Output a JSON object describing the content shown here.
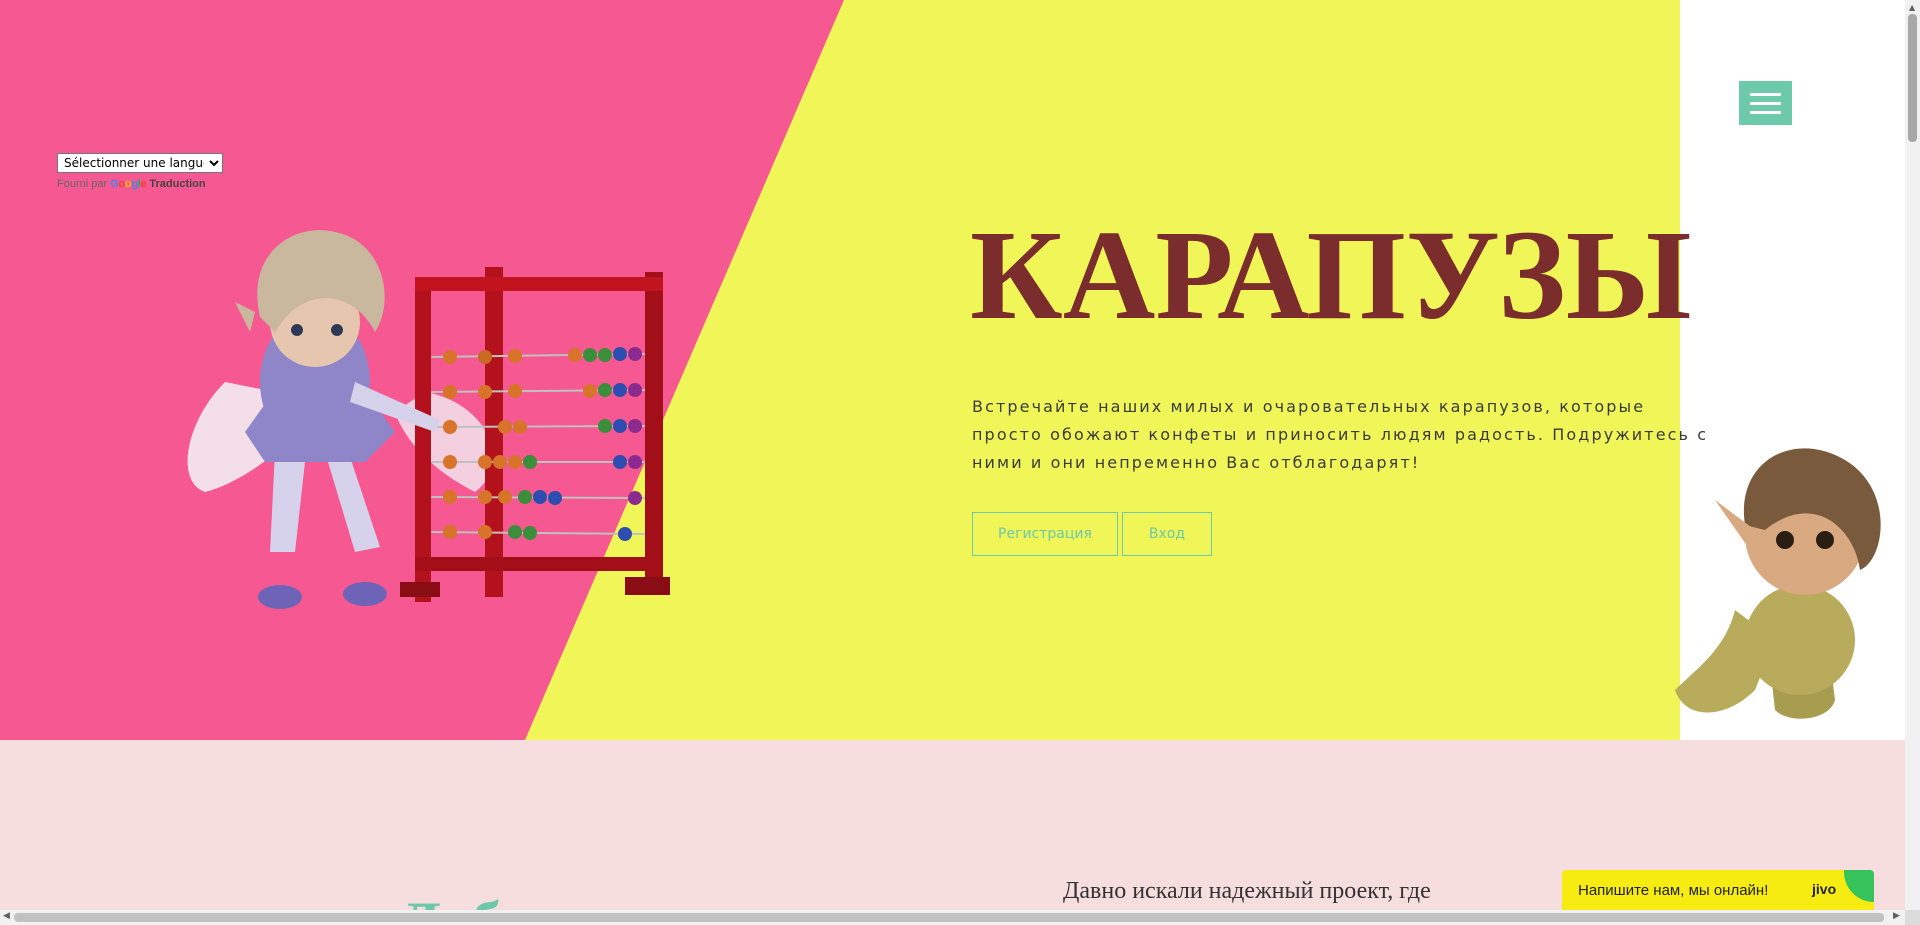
{
  "translate": {
    "select_value": "Sélectionner une langue",
    "powered_by": "Fourni par",
    "logo_parts": [
      "G",
      "o",
      "o",
      "g",
      "l",
      "e"
    ],
    "translate_label": "Traduction"
  },
  "hero": {
    "title": "КАРАПУЗЫ",
    "description": "Встречайте наших милых и очаровательных карапузов, которые просто обожают конфеты и приносить людям радость. Подружитесь с ними и они непременно Вас отблагодарят!",
    "register_label": "Регистрация",
    "login_label": "Вход"
  },
  "section2": {
    "heading": "Добро пожаловать",
    "text": "Давно искали надежный проект, где"
  },
  "chat": {
    "label": "Напишите нам, мы онлайн!",
    "logo": "jivo"
  },
  "colors": {
    "pink": "#f65891",
    "yellow": "#f0f657",
    "accent": "#6cc9aa",
    "title": "#7b2c2c",
    "section_bg": "#f6dede",
    "chat_bg": "#f7ec12"
  },
  "icons": {
    "menu": "hamburger-icon",
    "chat_badge": "chat-bubble-icon"
  }
}
